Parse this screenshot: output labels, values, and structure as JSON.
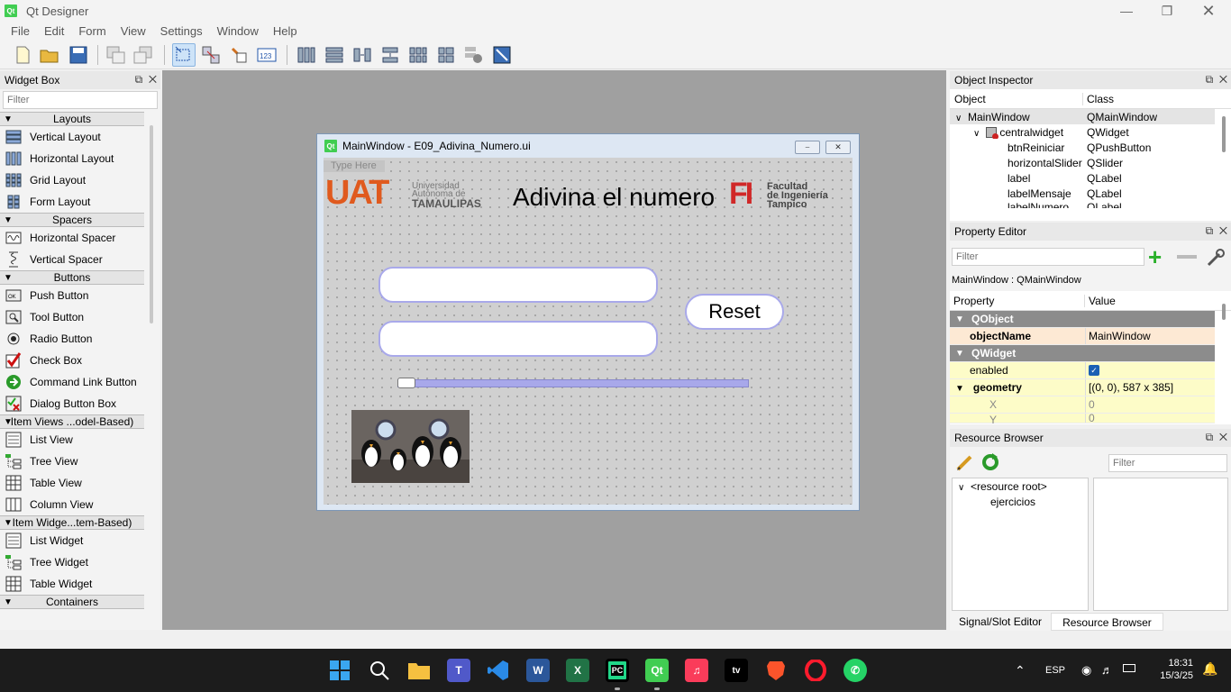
{
  "app": {
    "title": "Qt Designer",
    "logo": "Qt"
  },
  "menu": [
    "File",
    "Edit",
    "Form",
    "View",
    "Settings",
    "Window",
    "Help"
  ],
  "widget_box": {
    "title": "Widget Box",
    "filter_placeholder": "Filter",
    "categories": [
      {
        "label": "Layouts",
        "items": [
          "Vertical Layout",
          "Horizontal Layout",
          "Grid Layout",
          "Form Layout"
        ]
      },
      {
        "label": "Spacers",
        "items": [
          "Horizontal Spacer",
          "Vertical Spacer"
        ]
      },
      {
        "label": "Buttons",
        "items": [
          "Push Button",
          "Tool Button",
          "Radio Button",
          "Check Box",
          "Command Link Button",
          "Dialog Button Box"
        ]
      },
      {
        "label": "Item Views ...odel-Based)",
        "items": [
          "List View",
          "Tree View",
          "Table View",
          "Column View"
        ]
      },
      {
        "label": "Item Widge...tem-Based)",
        "items": [
          "List Widget",
          "Tree Widget",
          "Table Widget"
        ]
      },
      {
        "label": "Containers",
        "items": []
      }
    ]
  },
  "form": {
    "window_title": "MainWindow - E09_Adivina_Numero.ui",
    "type_here": "Type Here",
    "heading": "Adivina el numero",
    "reset_label": "Reset",
    "slider_value": 0,
    "uat_logo": {
      "mark": "UAT",
      "line1": "Universidad",
      "line2": "Autónoma de",
      "line3": "TAMAULIPAS"
    },
    "fi_logo": {
      "mark": "FI",
      "line1": "Facultad",
      "line2": "de Ingeniería",
      "line3": "Tampico"
    }
  },
  "object_inspector": {
    "title": "Object Inspector",
    "col_object": "Object",
    "col_class": "Class",
    "rows": [
      {
        "object": "MainWindow",
        "class": "QMainWindow"
      },
      {
        "object": "centralwidget",
        "class": "QWidget"
      },
      {
        "object": "btnReiniciar",
        "class": "QPushButton"
      },
      {
        "object": "horizontalSlider",
        "class": "QSlider"
      },
      {
        "object": "label",
        "class": "QLabel"
      },
      {
        "object": "labelMensaje",
        "class": "QLabel"
      },
      {
        "object": "labelNumero",
        "class": "QLabel"
      }
    ]
  },
  "property_editor": {
    "title": "Property Editor",
    "filter_placeholder": "Filter",
    "context": "MainWindow : QMainWindow",
    "col_property": "Property",
    "col_value": "Value",
    "group_qobject": "QObject",
    "objectName_label": "objectName",
    "objectName_value": "MainWindow",
    "group_qwidget": "QWidget",
    "enabled_label": "enabled",
    "geometry_label": "geometry",
    "geometry_value": "[(0, 0), 587 x 385]",
    "x_label": "X",
    "x_value": "0",
    "y_label": "Y",
    "y_value": "0"
  },
  "resource_browser": {
    "title": "Resource Browser",
    "filter_placeholder": "Filter",
    "root": "<resource root>",
    "child": "ejercicios"
  },
  "bottom_tabs": [
    "Signal/Slot Editor",
    "Resource Browser"
  ],
  "tray": {
    "lang": "ESP",
    "time": "18:31",
    "date": "15/3/25"
  },
  "colors": {
    "accent_purple": "#a9a9ea",
    "selection": "#cde3f8",
    "group_header": "#8c8c8c"
  }
}
